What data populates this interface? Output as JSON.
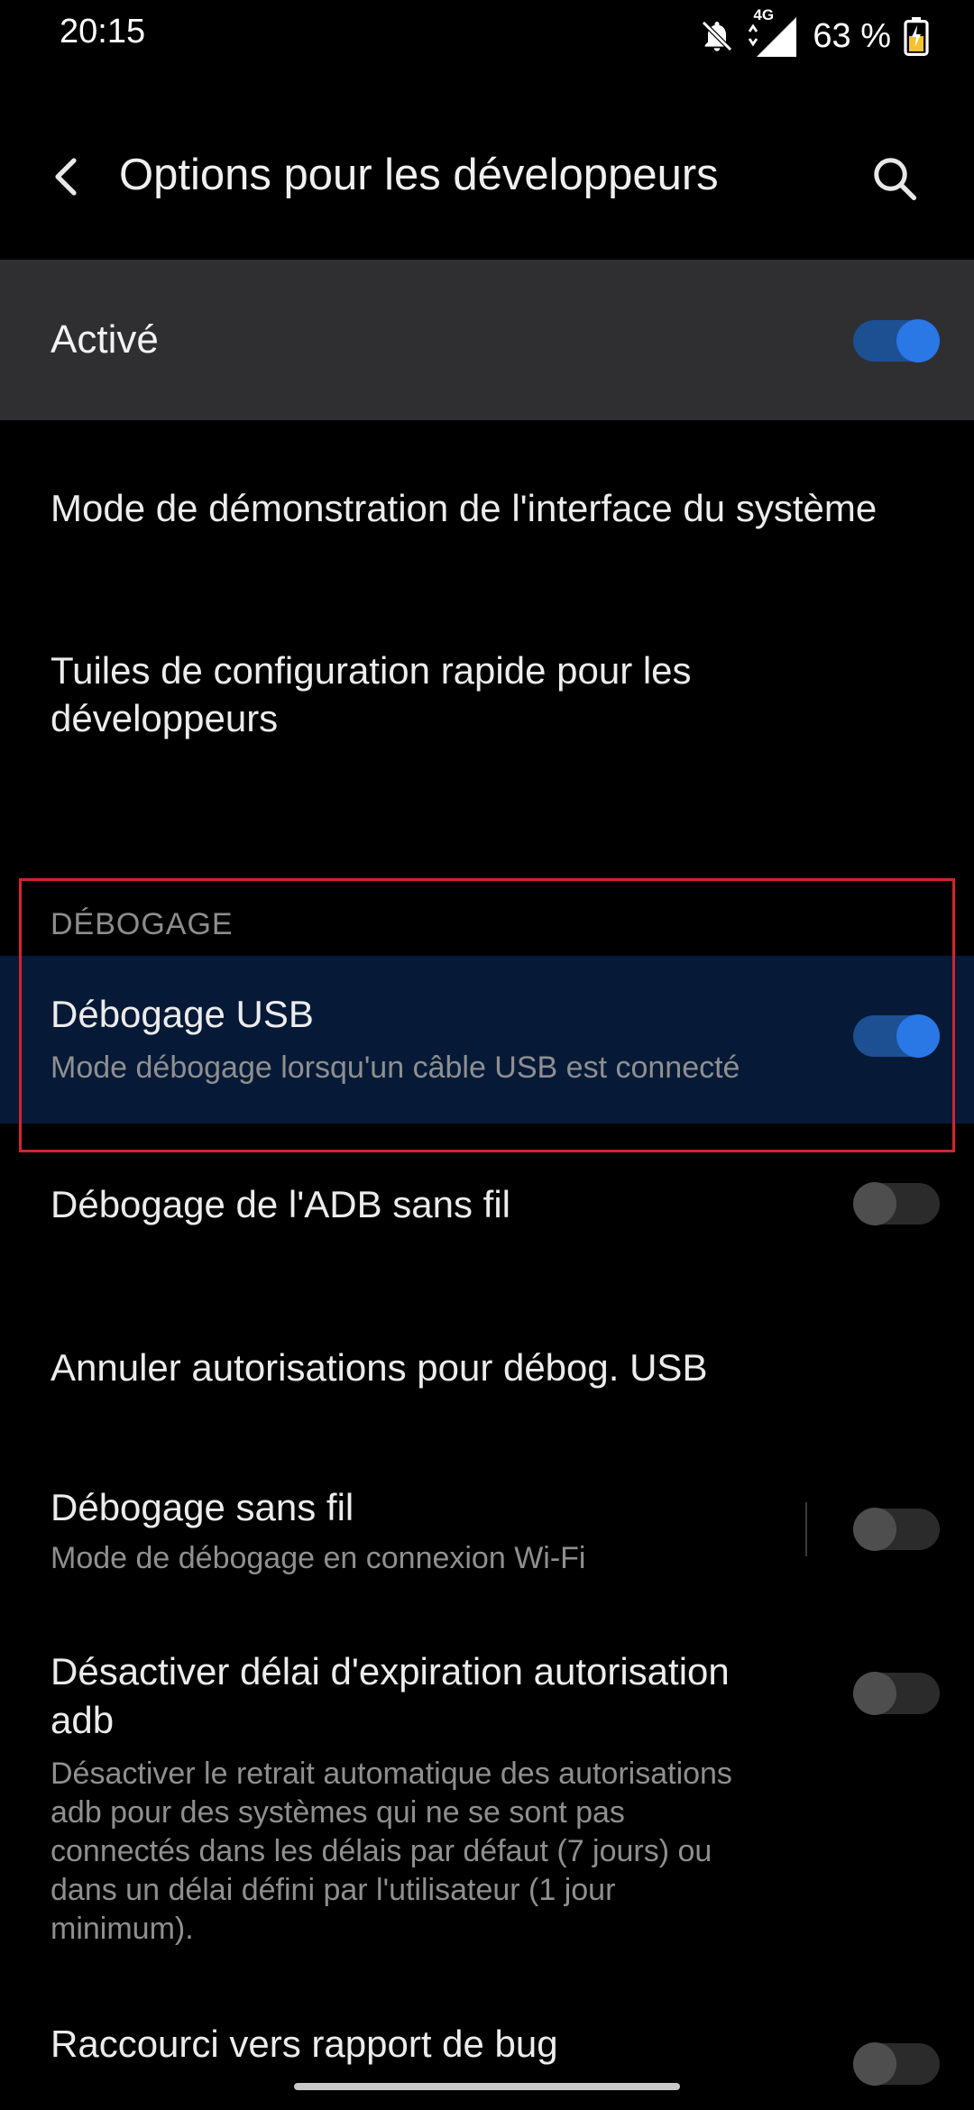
{
  "status_bar": {
    "time": "20:15",
    "network": "4G",
    "battery": "63 %",
    "icons": [
      "bell-off-icon",
      "signal-icon",
      "battery-charging-icon"
    ]
  },
  "header": {
    "title": "Options pour les développeurs",
    "back_icon": "arrow-left-icon",
    "search_icon": "search-icon"
  },
  "master_toggle": {
    "label": "Activé",
    "on": true
  },
  "items_top": [
    {
      "title": "Mode de démonstration de l'interface du système"
    },
    {
      "title_line1": "Tuiles de configuration rapide pour les",
      "title_line2": "développeurs"
    }
  ],
  "debug_section": {
    "header": "DÉBOGAGE",
    "usb_debugging": {
      "title": "Débogage USB",
      "subtitle": "Mode débogage lorsqu'un câble USB est connecté",
      "on": true
    },
    "adb_wireless": {
      "title": "Débogage de l'ADB sans fil",
      "on": false
    },
    "revoke_usb": {
      "title": "Annuler autorisations pour débog. USB"
    },
    "wireless_debugging": {
      "title": "Débogage sans fil",
      "subtitle": "Mode de débogage en connexion Wi-Fi",
      "on": false
    },
    "disable_adb_timeout": {
      "title_line1": "Désactiver délai d'expiration autorisation",
      "title_line2": "adb",
      "desc_lines": [
        "Désactiver le retrait automatique des autorisations",
        "adb pour des systèmes qui ne se sont pas",
        "connectés dans les délais par défaut (7 jours) ou",
        "dans un délai défini par l'utilisateur (1 jour",
        "minimum)."
      ],
      "on": false
    },
    "bug_report_shortcut": {
      "title": "Raccourci vers rapport de bug",
      "on": false
    }
  },
  "colors": {
    "background": "#000000",
    "master_band": "#2f2f31",
    "highlight": "#061a37",
    "accent": "#2a77e6",
    "annotation_border": "#d42330"
  }
}
